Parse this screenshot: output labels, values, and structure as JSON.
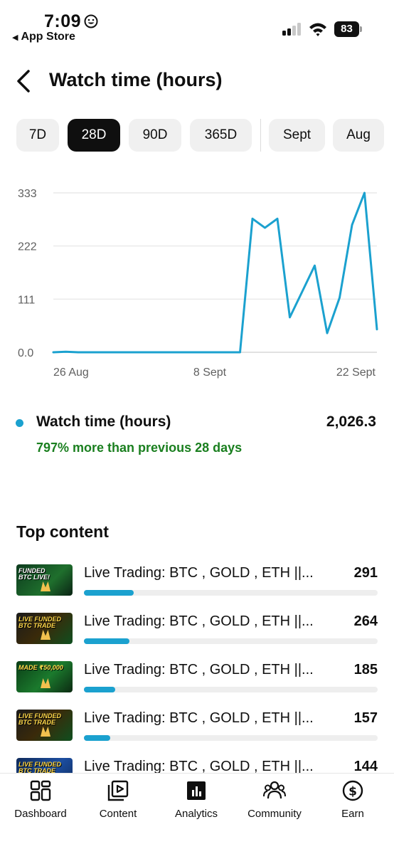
{
  "status_bar": {
    "time": "7:09",
    "back_app": "App Store",
    "battery": "83"
  },
  "header": {
    "title": "Watch time (hours)"
  },
  "tabs": [
    {
      "label": "7D",
      "active": false
    },
    {
      "label": "28D",
      "active": true
    },
    {
      "label": "90D",
      "active": false
    },
    {
      "label": "365D",
      "active": false
    },
    {
      "label": "Sept",
      "active": false
    },
    {
      "label": "Aug",
      "active": false
    }
  ],
  "chart_data": {
    "type": "line",
    "y_ticks": [
      "333",
      "222",
      "111",
      "0.0"
    ],
    "ylim": [
      0,
      333
    ],
    "x_ticks": [
      "26 Aug",
      "8 Sept",
      "22 Sept"
    ],
    "grid": true,
    "color": "#1ba1cf",
    "series": [
      {
        "values": [
          0,
          1,
          0,
          0,
          0,
          0,
          0,
          0,
          0,
          0,
          0,
          0,
          0,
          0,
          0,
          0,
          279,
          260,
          279,
          73,
          127,
          181,
          40,
          114,
          266,
          333,
          48
        ]
      }
    ]
  },
  "summary": {
    "label": "Watch time (hours)",
    "value": "2,026.3",
    "change": "797% more than previous 28 days",
    "dot_color": "#1ba1cf"
  },
  "top_content": {
    "title": "Top content",
    "items": [
      {
        "title": "Live Trading: BTC , GOLD , ETH ||...",
        "value": "291",
        "fraction": 0.17,
        "thumb_text": "FUNDED\nBTC LIVE!"
      },
      {
        "title": "Live Trading: BTC , GOLD , ETH ||...",
        "value": "264",
        "fraction": 0.155,
        "thumb_text": "LIVE FUNDED BTC TRADE"
      },
      {
        "title": "Live Trading: BTC , GOLD , ETH ||...",
        "value": "185",
        "fraction": 0.107,
        "thumb_text": "MADE ₹50,000"
      },
      {
        "title": "Live Trading: BTC , GOLD , ETH ||...",
        "value": "157",
        "fraction": 0.09,
        "thumb_text": "LIVE FUNDED BTC TRADE"
      },
      {
        "title": "Live Trading: BTC , GOLD , ETH ||...",
        "value": "144",
        "fraction": 0.08,
        "thumb_text": "LIVE FUNDED BTC TRADE"
      }
    ]
  },
  "bottom_nav": [
    {
      "label": "Dashboard",
      "icon": "dashboard-icon"
    },
    {
      "label": "Content",
      "icon": "content-icon"
    },
    {
      "label": "Analytics",
      "icon": "analytics-icon",
      "active": true
    },
    {
      "label": "Community",
      "icon": "community-icon"
    },
    {
      "label": "Earn",
      "icon": "earn-icon"
    }
  ]
}
